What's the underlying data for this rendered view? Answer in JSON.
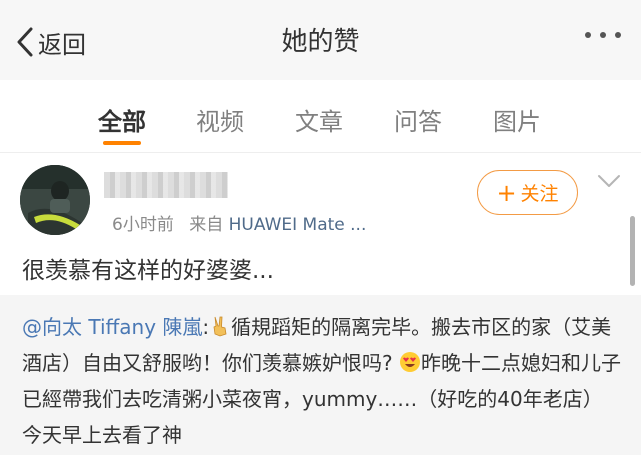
{
  "header": {
    "back_label": "返回",
    "title": "她的赞"
  },
  "tabs": [
    {
      "label": "全部",
      "active": true
    },
    {
      "label": "视频",
      "active": false
    },
    {
      "label": "文章",
      "active": false
    },
    {
      "label": "问答",
      "active": false
    },
    {
      "label": "图片",
      "active": false
    }
  ],
  "post": {
    "time": "6小时前",
    "source_prefix": "来自",
    "device": "HUAWEI Mate ...",
    "follow_label": "关注",
    "text": "很羡慕有这样的好婆婆...",
    "repost": {
      "mention": "@向太 Tiffany 陳嵐",
      "colon": ":",
      "line1_rest": "循規蹈矩的隔离完毕。搬去市区的家（艾美酒店）自由又舒服哟！你们羡慕嫉妒恨吗?",
      "line2": "昨晚十二点媳妇和儿子已經帶我们去吃清粥小菜夜宵，yummy……（好吃的40年老店）今天早上去看了神"
    }
  },
  "colors": {
    "accent": "#ff8200",
    "link": "#4a78b4",
    "topbar_bg": "#f7f7f7",
    "repost_bg": "#f5f5f5"
  },
  "icons": {
    "back": "chevron-left-icon",
    "more": "more-dots-icon",
    "dropdown": "chevron-down-icon",
    "victory": "victory-hand-emoji",
    "hearts": "heart-eyes-emoji"
  }
}
